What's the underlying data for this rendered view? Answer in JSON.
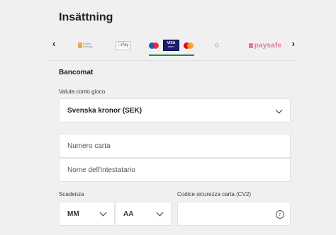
{
  "header": {
    "title": "Insättning"
  },
  "payment_methods": {
    "items": [
      {
        "name": "pocket",
        "label": "Pocket\nBankApp"
      },
      {
        "name": "apple-pay",
        "label": "Pay"
      },
      {
        "name": "cards",
        "label": "VISA",
        "sublabel": "DEBIT",
        "selected": true
      },
      {
        "name": "google-pay",
        "label": "G"
      },
      {
        "name": "paysafe",
        "label": "paysafe"
      }
    ],
    "prev_icon": "chevron-left-icon",
    "next_icon": "chevron-right-icon",
    "selected_color": "#1c8a4c"
  },
  "form": {
    "section_title": "Bancomat",
    "currency_label": "Valuta conto gioco",
    "currency_value": "Svenska kronor (SEK)",
    "card_number_placeholder": "Numero carta",
    "holder_name_placeholder": "Nome dell'intestatario",
    "expiry_label": "Scadenza",
    "expiry_month": "MM",
    "expiry_year": "AA",
    "cvv_label": "Codice sicurezza carta (CV2)",
    "cvv_info_icon": "info-icon"
  }
}
